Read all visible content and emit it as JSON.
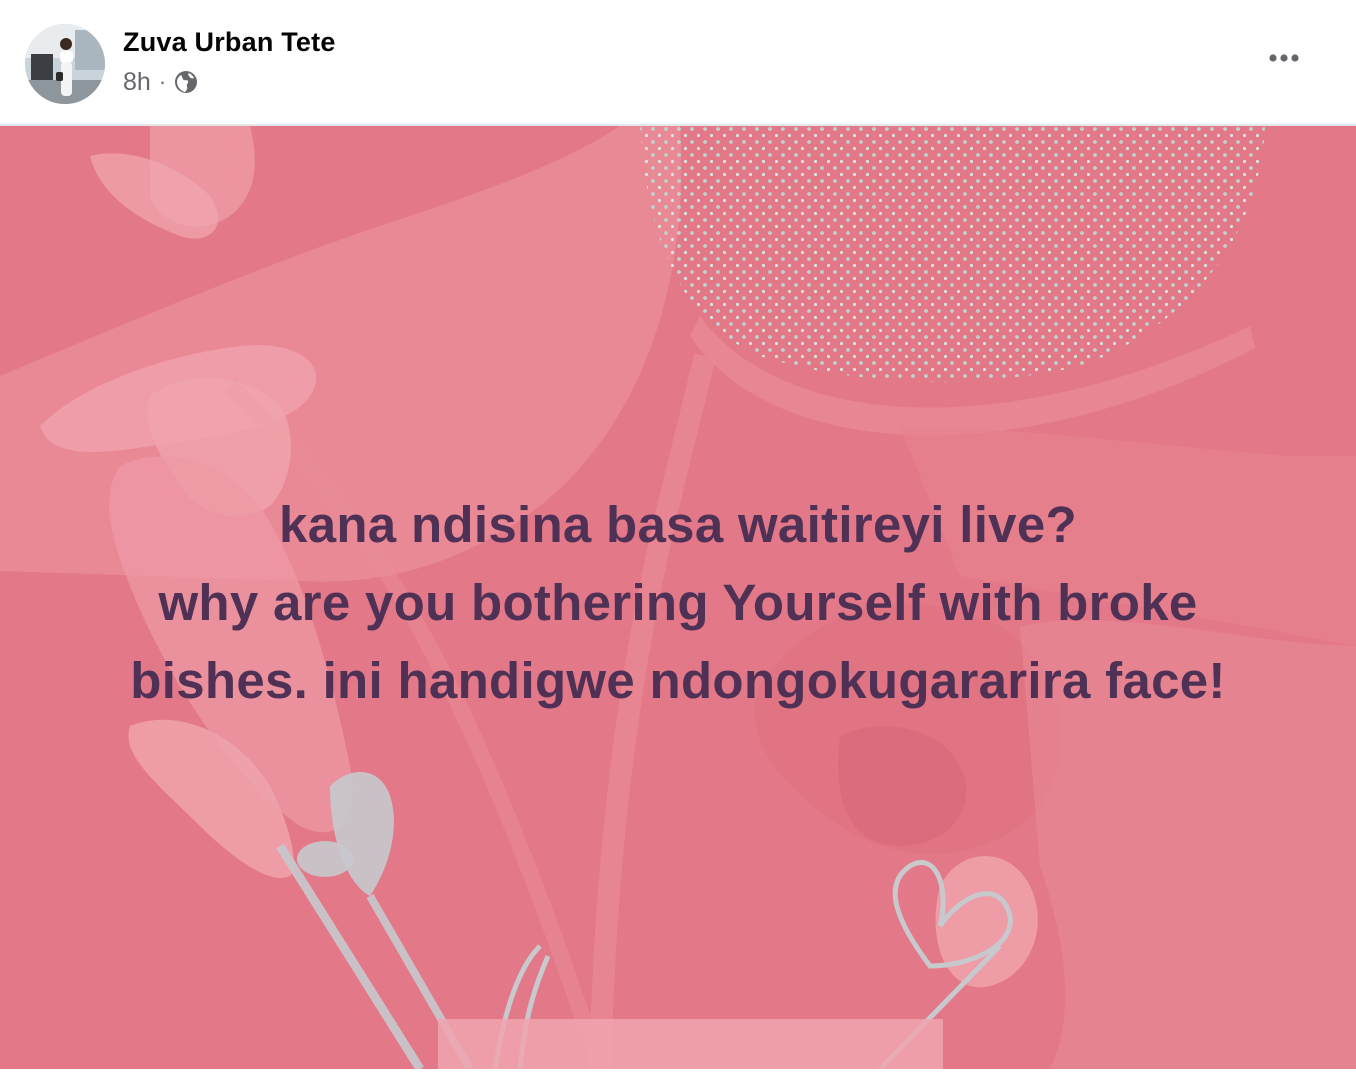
{
  "post": {
    "author": {
      "name": "Zuva Urban Tete",
      "avatar_icon": "profile-photo"
    },
    "timestamp": "8h",
    "separator": "·",
    "audience_icon": "globe-icon",
    "more_icon": "more-horizontal-icon",
    "background": {
      "color": "#e37888",
      "text_color": "#4e3155"
    },
    "text_lines": [
      "kana ndisina basa waitireyi live?",
      "why are you bothering Yourself with broke",
      "bishes. ini handigwe ndongokugararira face!"
    ]
  }
}
